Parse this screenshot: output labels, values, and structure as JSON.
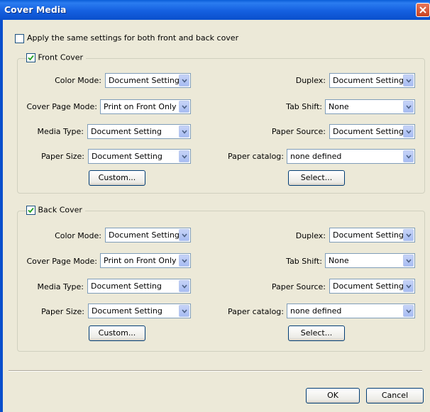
{
  "window": {
    "title": "Cover Media"
  },
  "apply_same": {
    "label": "Apply the same settings for both front and back cover",
    "checked": false
  },
  "labels": {
    "color_mode": "Color Mode:",
    "duplex": "Duplex:",
    "cover_page_mode": "Cover Page Mode:",
    "tab_shift": "Tab Shift:",
    "media_type": "Media Type:",
    "paper_source": "Paper Source:",
    "paper_size": "Paper Size:",
    "paper_catalog": "Paper catalog:"
  },
  "front": {
    "title": "Front Cover",
    "checked": true,
    "color_mode": "Document Setting",
    "duplex": "Document Setting",
    "cover_page_mode": "Print on Front Only",
    "tab_shift": "None",
    "media_type": "Document Setting",
    "paper_source": "Document Setting",
    "paper_size": "Document Setting",
    "paper_catalog": "none defined",
    "custom_label": "Custom...",
    "select_label": "Select..."
  },
  "back": {
    "title": "Back Cover",
    "checked": true,
    "color_mode": "Document Setting",
    "duplex": "Document Setting",
    "cover_page_mode": "Print on Front Only",
    "tab_shift": "None",
    "media_type": "Document Setting",
    "paper_source": "Document Setting",
    "paper_size": "Document Setting",
    "paper_catalog": "none defined",
    "custom_label": "Custom...",
    "select_label": "Select..."
  },
  "buttons": {
    "ok": "OK",
    "cancel": "Cancel"
  },
  "icons": {
    "close": "close-icon",
    "dropdown": "chevron-down-icon",
    "check": "checkmark-icon"
  }
}
